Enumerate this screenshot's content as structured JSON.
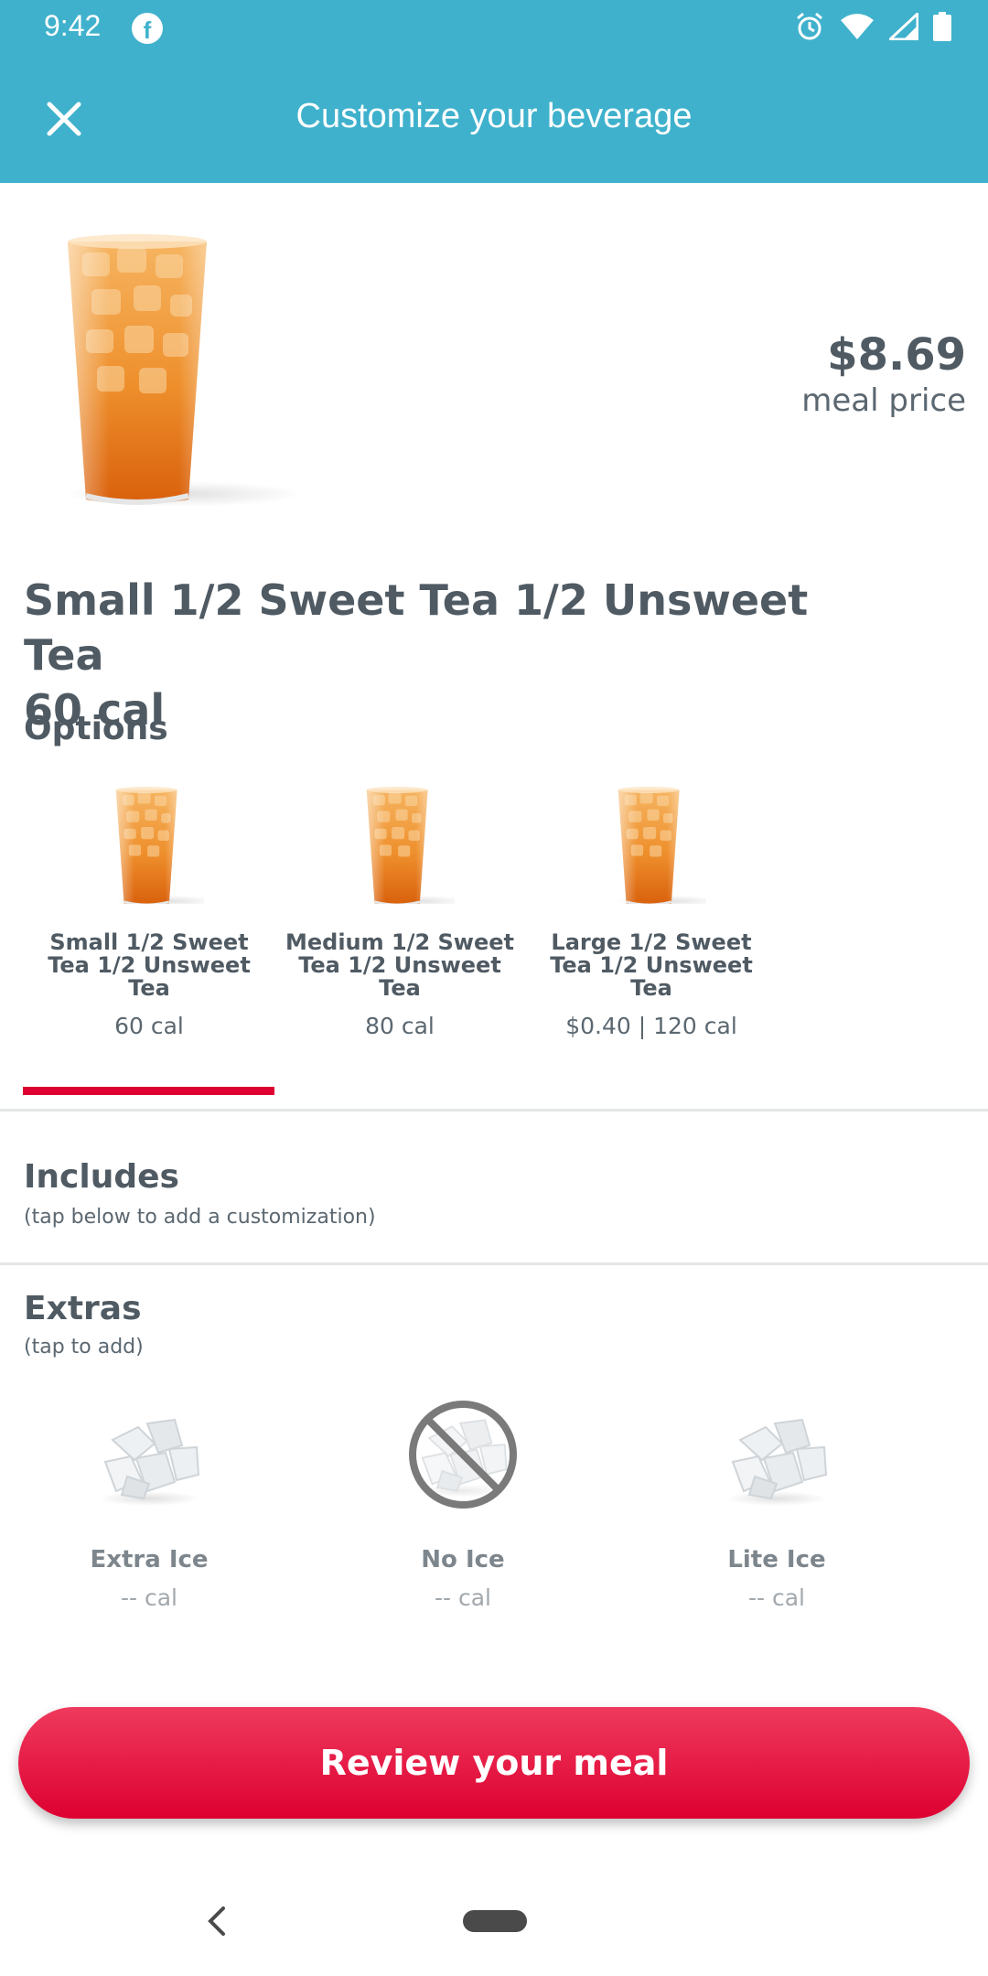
{
  "status_bar": {
    "time": "9:42",
    "notification_icon": "facebook-icon",
    "icons": [
      "alarm-icon",
      "wifi-icon",
      "signal-icon",
      "battery-icon"
    ]
  },
  "header": {
    "title": "Customize your beverage",
    "close_icon": "close-icon"
  },
  "product": {
    "name": "Small 1/2 Sweet Tea 1/2 Unsweet Tea",
    "calories": "60 cal",
    "price": "$8.69",
    "price_label": "meal price"
  },
  "options": {
    "title": "Options",
    "items": [
      {
        "name": "Small 1/2 Sweet Tea 1/2 Unsweet Tea",
        "meta": "60 cal",
        "selected": true
      },
      {
        "name": "Medium 1/2 Sweet Tea 1/2 Unsweet Tea",
        "meta": "80 cal",
        "selected": false
      },
      {
        "name": "Large 1/2 Sweet Tea 1/2 Unsweet Tea",
        "meta": "$0.40 | 120 cal",
        "selected": false
      }
    ]
  },
  "includes": {
    "title": "Includes",
    "hint": "(tap below to add a customization)"
  },
  "extras": {
    "title": "Extras",
    "hint": "(tap to add)",
    "items": [
      {
        "name": "Extra Ice",
        "calories": "-- cal",
        "icon": "ice-icon"
      },
      {
        "name": "No Ice",
        "calories": "-- cal",
        "icon": "no-ice-icon"
      },
      {
        "name": "Lite Ice",
        "calories": "-- cal",
        "icon": "ice-icon"
      }
    ]
  },
  "cta": {
    "label": "Review your meal"
  },
  "colors": {
    "header": "#3fb1cc",
    "accent": "#dd0031",
    "text": "#4f5a63"
  }
}
